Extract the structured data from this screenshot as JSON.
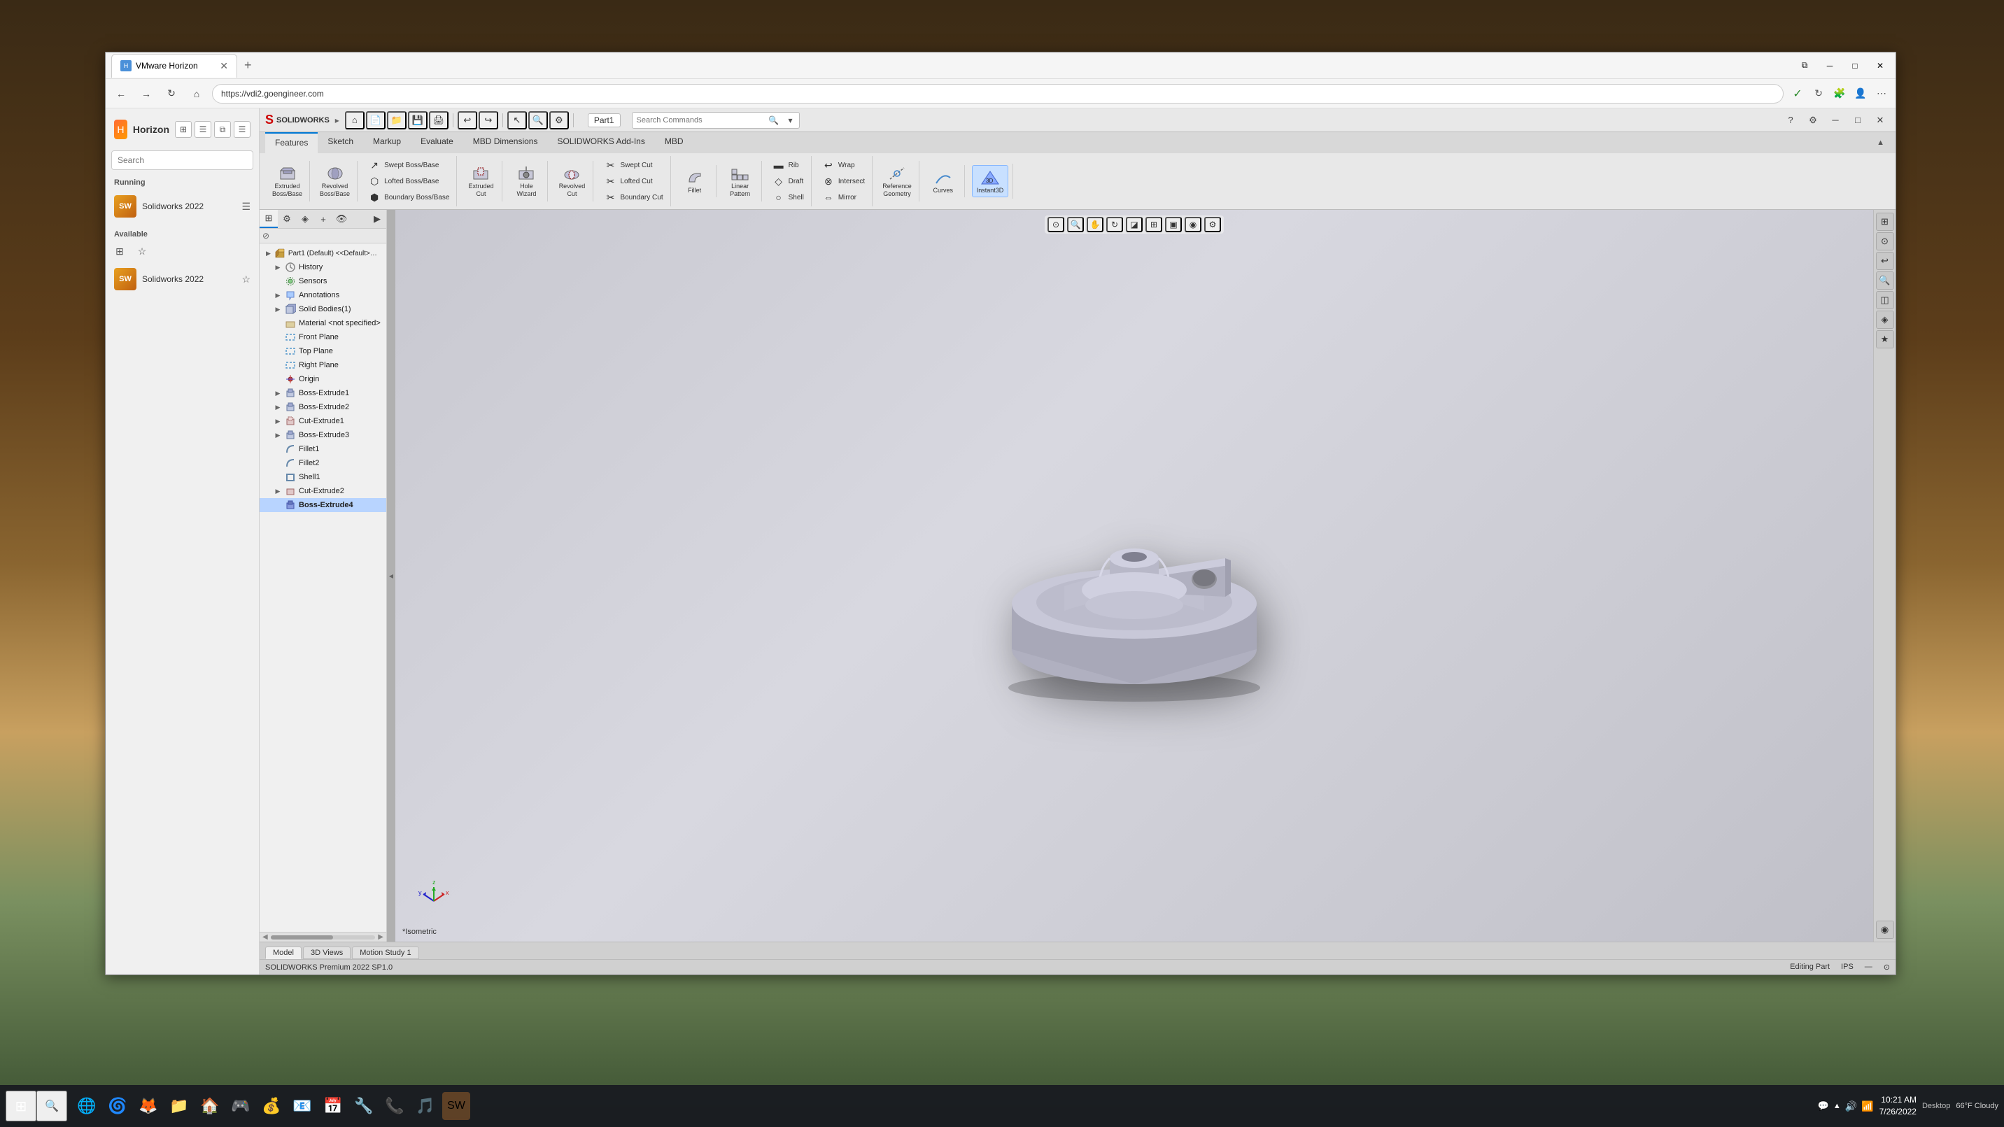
{
  "browser": {
    "tab_title": "VMware Horizon",
    "tab_icon": "H",
    "url": "https://vdi2.goengineer.com",
    "add_tab": "+",
    "nav": {
      "back": "←",
      "forward": "→",
      "refresh": "↻",
      "home": "⌂"
    },
    "win_controls": {
      "minimize": "─",
      "maximize": "□",
      "close": "✕"
    }
  },
  "horizon": {
    "title": "Horizon",
    "logo": "H",
    "search_placeholder": "Search",
    "sections": {
      "running_label": "Running",
      "available_label": "Available"
    },
    "running_apps": [
      {
        "name": "Solidworks 2022",
        "icon": "SW"
      }
    ],
    "available_apps": [
      {
        "name": "Solidworks 2022",
        "icon": "SW"
      }
    ]
  },
  "solidworks": {
    "logo_mark": "S",
    "logo_text": "SOLIDWORKS",
    "part_name": "Part1",
    "title_bar_arrow": "▸",
    "search_placeholder": "Search Commands",
    "win_controls": {
      "minimize": "─",
      "maximize": "□",
      "close": "✕"
    },
    "ribbon": {
      "tabs": [
        "Features",
        "Sketch",
        "Markup",
        "Evaluate",
        "MBD Dimensions",
        "SOLIDWORKS Add-Ins",
        "MBD"
      ],
      "active_tab": "Features",
      "groups": {
        "extrude_boss": "Extruded\nBoss/Base",
        "revolved_boss": "Revolved\nBoss/Base",
        "swept_boss_base": "Swept Boss/Base",
        "lofted_boss_base": "Lofted Boss/Base",
        "boundary_boss_base": "Boundary Boss/Base",
        "extruded_cut": "Extruded\nCut",
        "hole_wizard": "Hole\nWizard",
        "revolved_cut": "Revolved\nCut",
        "swept_cut": "Swept Cut",
        "lofted_cut": "Lofted Cut",
        "boundary_cut": "Boundary Cut",
        "fillet": "Fillet",
        "linear_pattern": "Linear\nPattern",
        "draft": "Draft",
        "rib": "Rib",
        "shell": "Shell",
        "wrap": "Wrap",
        "intersect": "Intersect",
        "mirror": "Mirror",
        "reference_geometry": "Reference\nGeometry",
        "curves": "Curves",
        "instant3d": "Instant3D"
      }
    },
    "tree": {
      "header": "Part1 (Default) <<Default>_Display Str...",
      "items": [
        {
          "label": "History",
          "icon": "📋",
          "level": 1,
          "expandable": true
        },
        {
          "label": "Sensors",
          "icon": "📡",
          "level": 1,
          "expandable": false
        },
        {
          "label": "Annotations",
          "icon": "✏️",
          "level": 1,
          "expandable": true
        },
        {
          "label": "Solid Bodies(1)",
          "icon": "⬛",
          "level": 1,
          "expandable": true
        },
        {
          "label": "Material <not specified>",
          "icon": "🔲",
          "level": 1,
          "expandable": false
        },
        {
          "label": "Front Plane",
          "icon": "▭",
          "level": 1,
          "expandable": false
        },
        {
          "label": "Top Plane",
          "icon": "▭",
          "level": 1,
          "expandable": false
        },
        {
          "label": "Right Plane",
          "icon": "▭",
          "level": 1,
          "expandable": false
        },
        {
          "label": "Origin",
          "icon": "⊕",
          "level": 1,
          "expandable": false
        },
        {
          "label": "Boss-Extrude1",
          "icon": "📦",
          "level": 1,
          "expandable": true
        },
        {
          "label": "Boss-Extrude2",
          "icon": "📦",
          "level": 1,
          "expandable": true
        },
        {
          "label": "Cut-Extrude1",
          "icon": "✂️",
          "level": 1,
          "expandable": true
        },
        {
          "label": "Boss-Extrude3",
          "icon": "📦",
          "level": 1,
          "expandable": true
        },
        {
          "label": "Fillet1",
          "icon": "🔘",
          "level": 1,
          "expandable": false
        },
        {
          "label": "Fillet2",
          "icon": "🔘",
          "level": 1,
          "expandable": false
        },
        {
          "label": "Shell1",
          "icon": "🐚",
          "level": 1,
          "expandable": false
        },
        {
          "label": "Cut-Extrude2",
          "icon": "✂️",
          "level": 1,
          "expandable": true
        },
        {
          "label": "Boss-Extrude4",
          "icon": "📦",
          "level": 1,
          "expandable": false,
          "selected": true
        }
      ]
    },
    "bottom_tabs": [
      "Model",
      "3D Views",
      "Motion Study 1"
    ],
    "active_bottom_tab": "Model",
    "status": {
      "version": "SOLIDWORKS Premium 2022 SP1.0",
      "editing": "Editing Part",
      "units": "IPS"
    },
    "viewport": {
      "view_label": "*Isometric"
    }
  },
  "taskbar": {
    "start_icon": "⊞",
    "search_icon": "🔍",
    "time": "10:21 AM",
    "date": "7/26/2022",
    "desktop_label": "Desktop",
    "weather": "66°F Cloudy",
    "apps": [
      "🌐",
      "🦊",
      "🌀",
      "📁",
      "🏠",
      "🎮",
      "💰",
      "📧",
      "📅",
      "🔧",
      "📞",
      "🎵"
    ],
    "sys_icons": [
      "🔊",
      "📶",
      "🔋"
    ]
  }
}
